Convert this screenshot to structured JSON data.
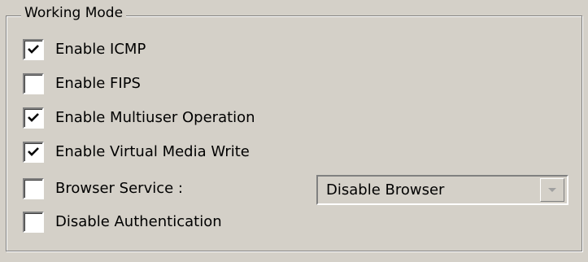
{
  "group": {
    "title": "Working Mode"
  },
  "options": [
    {
      "label": "Enable ICMP",
      "checked": true
    },
    {
      "label": "Enable FIPS",
      "checked": false
    },
    {
      "label": "Enable Multiuser Operation",
      "checked": true
    },
    {
      "label": "Enable Virtual Media Write",
      "checked": true
    },
    {
      "label": "Browser Service :",
      "checked": false
    },
    {
      "label": "Disable Authentication",
      "checked": false
    }
  ],
  "browser_service": {
    "selected": "Disable Browser"
  },
  "colors": {
    "background": "#d4d0c8",
    "shadow": "#808080",
    "highlight": "#ffffff"
  }
}
